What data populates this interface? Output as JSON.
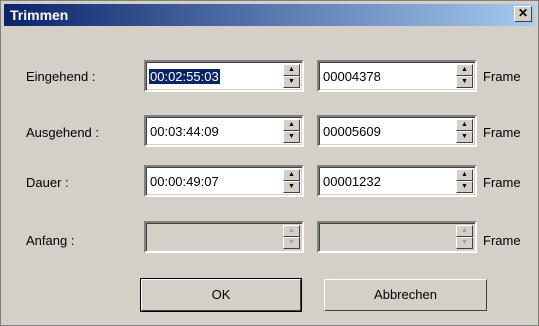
{
  "window": {
    "title": "Trimmen",
    "close_glyph": "✕"
  },
  "rows": [
    {
      "label": "Eingehend :",
      "timecode": "00:02:55:03",
      "frames": "00004378",
      "unit": "Frame"
    },
    {
      "label": "Ausgehend :",
      "timecode": "00:03:44:09",
      "frames": "00005609",
      "unit": "Frame"
    },
    {
      "label": "Dauer :",
      "timecode": "00:00:49:07",
      "frames": "00001232",
      "unit": "Frame"
    },
    {
      "label": "Anfang :",
      "timecode": "",
      "frames": "",
      "unit": "Frame"
    }
  ],
  "buttons": {
    "ok": "OK",
    "cancel": "Abbrechen"
  },
  "icons": {
    "spin_up": "▲",
    "spin_down": "▼"
  }
}
